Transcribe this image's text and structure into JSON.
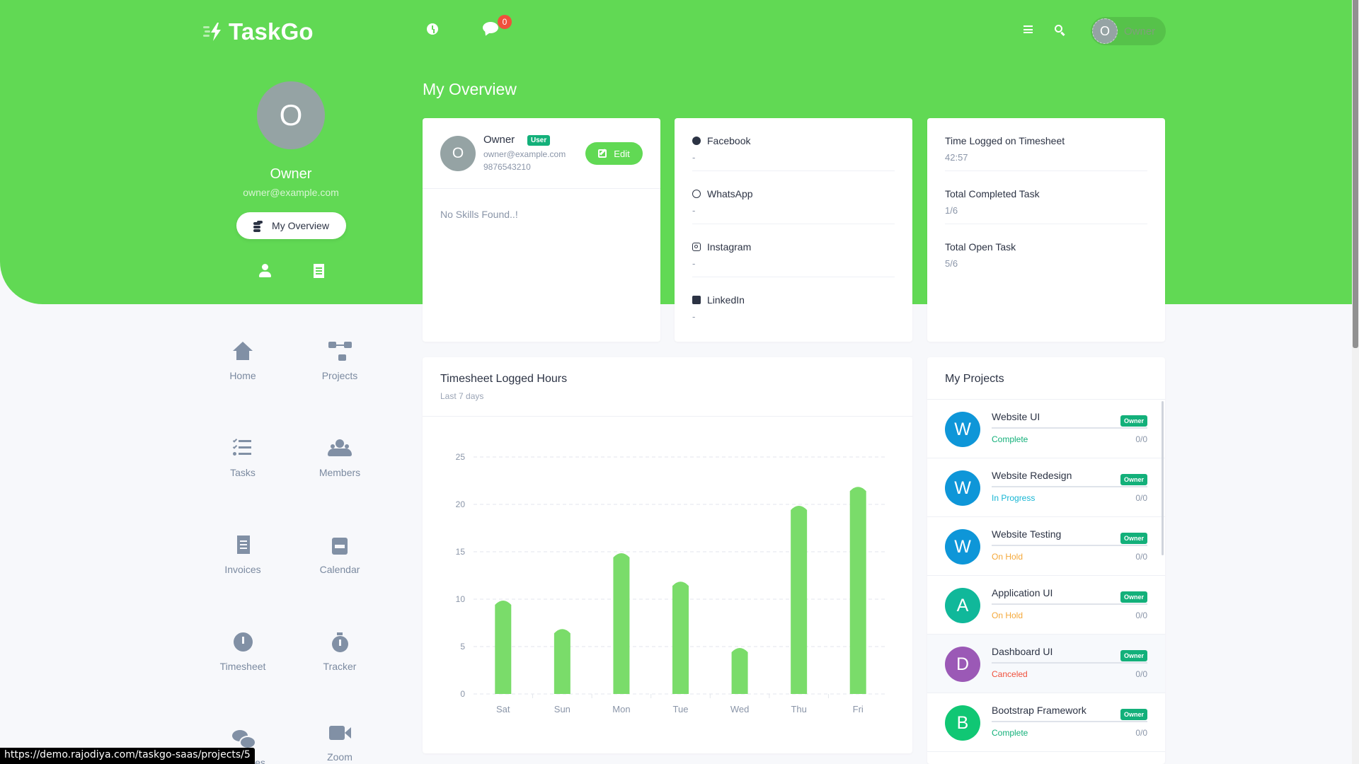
{
  "header": {
    "brand": "TaskGo",
    "notification_count": "0",
    "user_name": "Owner",
    "user_initial": "O"
  },
  "profile": {
    "initial": "O",
    "name": "Owner",
    "email": "owner@example.com",
    "overview_button": "My Overview"
  },
  "nav": [
    {
      "label": "Home",
      "icon": "home-icon"
    },
    {
      "label": "Projects",
      "icon": "projects-icon"
    },
    {
      "label": "Tasks",
      "icon": "tasks-icon"
    },
    {
      "label": "Members",
      "icon": "members-icon"
    },
    {
      "label": "Invoices",
      "icon": "invoice-icon"
    },
    {
      "label": "Calendar",
      "icon": "calendar-icon"
    },
    {
      "label": "Timesheet",
      "icon": "clock-icon"
    },
    {
      "label": "Tracker",
      "icon": "stopwatch-icon"
    },
    {
      "label": "Messages",
      "icon": "chat-icon"
    },
    {
      "label": "Zoom",
      "icon": "video-icon"
    }
  ],
  "page_title": "My Overview",
  "profile_card": {
    "initial": "O",
    "name": "Owner",
    "role": "User",
    "email": "owner@example.com",
    "phone": "9876543210",
    "edit_label": "Edit",
    "skills_text": "No Skills Found..!"
  },
  "social": [
    {
      "label": "Facebook",
      "value": "-"
    },
    {
      "label": "WhatsApp",
      "value": "-"
    },
    {
      "label": "Instagram",
      "value": "-"
    },
    {
      "label": "LinkedIn",
      "value": "-"
    }
  ],
  "stats": [
    {
      "label": "Time Logged on Timesheet",
      "value": "42:57"
    },
    {
      "label": "Total Completed Task",
      "value": "1/6"
    },
    {
      "label": "Total Open Task",
      "value": "5/6"
    }
  ],
  "chart_card": {
    "title": "Timesheet Logged Hours",
    "subtitle": "Last 7 days"
  },
  "chart_data": {
    "type": "bar",
    "title": "Timesheet Logged Hours",
    "subtitle": "Last 7 days",
    "categories": [
      "Sat",
      "Sun",
      "Mon",
      "Tue",
      "Wed",
      "Thu",
      "Fri"
    ],
    "values": [
      10,
      7,
      15,
      12,
      5,
      20,
      22
    ],
    "xlabel": "",
    "ylabel": "",
    "ylim": [
      0,
      25
    ],
    "yticks": [
      0,
      5,
      10,
      15,
      20,
      25
    ],
    "grid": true,
    "color": "#7adc6a"
  },
  "projects": {
    "title": "My Projects",
    "items": [
      {
        "initial": "W",
        "name": "Website UI",
        "role": "Owner",
        "status": "Complete",
        "status_color": "#13b07a",
        "count": "0/0",
        "color": "#0e96d8"
      },
      {
        "initial": "W",
        "name": "Website Redesign",
        "role": "Owner",
        "status": "In Progress",
        "status_color": "#17b6d4",
        "count": "0/0",
        "color": "#0e96d8"
      },
      {
        "initial": "W",
        "name": "Website Testing",
        "role": "Owner",
        "status": "On Hold",
        "status_color": "#f4a83a",
        "count": "0/0",
        "color": "#0e96d8"
      },
      {
        "initial": "A",
        "name": "Application UI",
        "role": "Owner",
        "status": "On Hold",
        "status_color": "#f4a83a",
        "count": "0/0",
        "color": "#10b89a"
      },
      {
        "initial": "D",
        "name": "Dashboard UI",
        "role": "Owner",
        "status": "Canceled",
        "status_color": "#f0503c",
        "count": "0/0",
        "color": "#9b59b6"
      },
      {
        "initial": "B",
        "name": "Bootstrap Framework",
        "role": "Owner",
        "status": "Complete",
        "status_color": "#13b07a",
        "count": "0/0",
        "color": "#10c774"
      }
    ]
  },
  "status_bar_url": "https://demo.rajodiya.com/taskgo-saas/projects/5",
  "colors": {
    "brand_green": "#61d954",
    "success": "#13b07a",
    "danger": "#f0503c"
  }
}
